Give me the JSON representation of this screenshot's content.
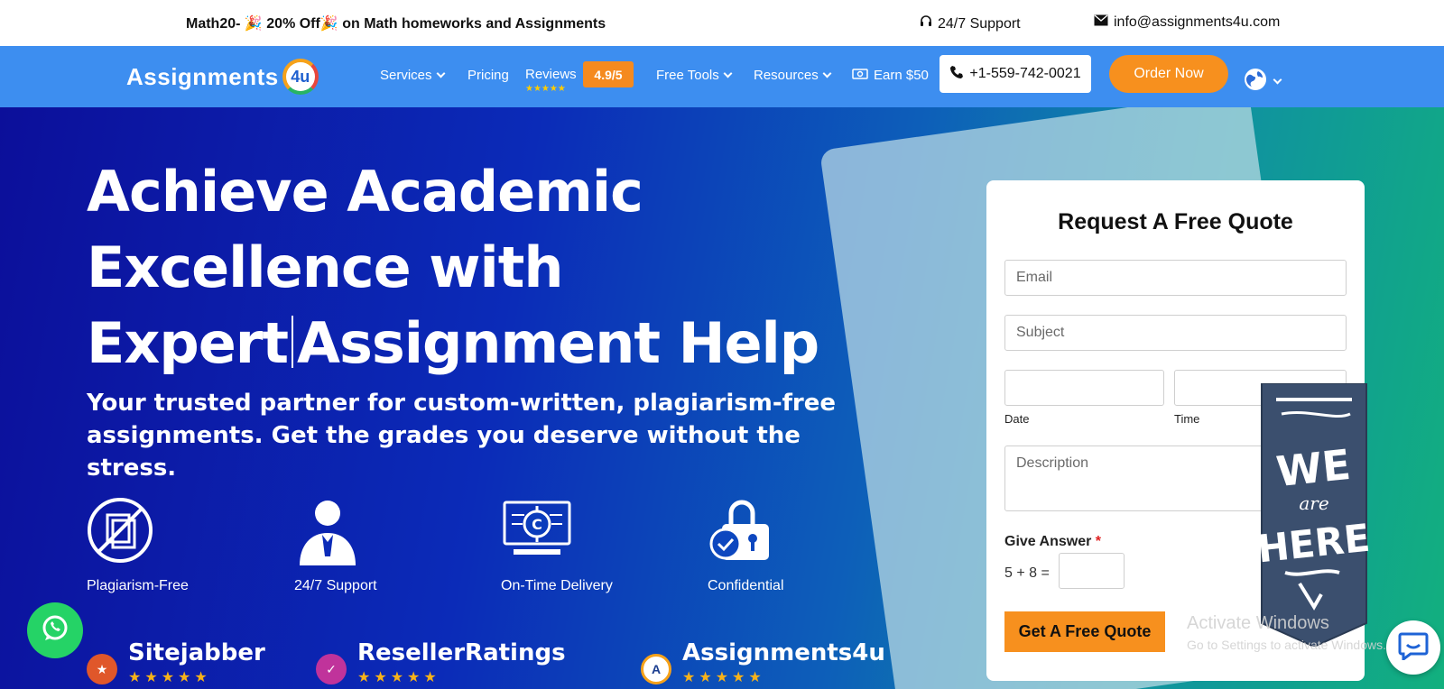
{
  "topbar": {
    "promo": "Math20- 🎉 20% Off🎉  on Math homeworks and Assignments",
    "support": "24/7 Support",
    "email": "info@assignments4u.com"
  },
  "nav": {
    "logo_text": "Assignments",
    "logo_badge": "4u",
    "items": {
      "services": "Services",
      "pricing": "Pricing",
      "reviews": "Reviews",
      "free_tools": "Free Tools",
      "resources": "Resources",
      "earn": "Earn $50"
    },
    "rating": "4.9/5",
    "reviews_stars": "★★★★★",
    "phone": "+1-559-742-0021",
    "order": "Order Now"
  },
  "hero": {
    "headline_line1": "Achieve Academic",
    "headline_line2": "Excellence with",
    "headline_line3a": "Expert",
    "headline_line3b": "Assignment Help",
    "subtitle": "Your trusted partner for custom-written, plagiarism-free assignments. Get the grades you deserve without the stress.",
    "features": [
      {
        "label": "Plagiarism-Free",
        "icon": "no-copy-icon"
      },
      {
        "label": "24/7 Support",
        "icon": "support-agent-icon"
      },
      {
        "label": "On-Time Delivery",
        "icon": "book-clock-icon"
      },
      {
        "label": "Confidential",
        "icon": "lock-check-icon"
      }
    ],
    "review_sites": [
      {
        "name": "Sitejabber",
        "stars": "★★★★★",
        "color": "#e0572a"
      },
      {
        "name": "ResellerRatings",
        "stars": "★★★★★",
        "color": "#c0339b"
      },
      {
        "name": "Assignments4u",
        "stars": "★★★★★",
        "color": "#1a3d8f"
      }
    ]
  },
  "quote": {
    "title": "Request A Free Quote",
    "email_placeholder": "Email",
    "subject_placeholder": "Subject",
    "date_label": "Date",
    "time_label": "Time",
    "description_placeholder": "Description",
    "give_answer": "Give Answer",
    "required_mark": "*",
    "captcha": "5 + 8 =",
    "submit": "Get A Free Quote"
  },
  "ribbon": {
    "line1": "WE",
    "line2": "are",
    "line3": "HERE"
  },
  "watermark": {
    "line1": "Activate Windows",
    "line2": "Go to Settings to activate Windows."
  },
  "colors": {
    "nav_blue": "#3d8ef0",
    "orange": "#f7901e",
    "whatsapp": "#25d366"
  }
}
